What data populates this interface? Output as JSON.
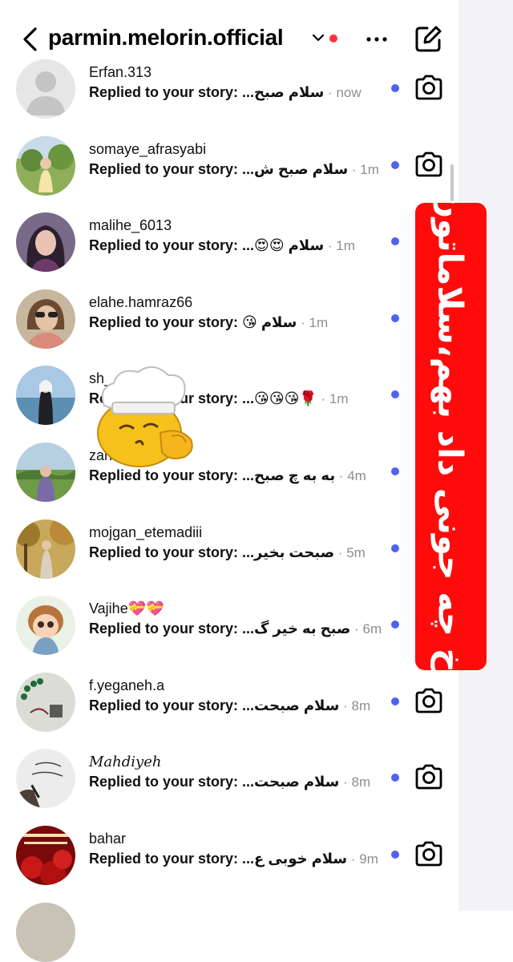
{
  "header": {
    "title": "parmin.melorin.official"
  },
  "threads": [
    {
      "username": "Erfan.313",
      "prefix": "Replied to your story:",
      "preview": "سلام صبح...",
      "time": "now",
      "avatar": "default",
      "camera": true
    },
    {
      "username": "somaye_afrasyabi",
      "prefix": "Replied to your story:",
      "preview": "سلام صبح ش...",
      "time": "1m",
      "avatar": "garden",
      "camera": true
    },
    {
      "username": "malihe_6013",
      "prefix": "Replied to your story:",
      "preview": "سلام 😍😍...",
      "time": "1m",
      "avatar": "portrait",
      "camera": false
    },
    {
      "username": "elahe.hamraz66",
      "prefix": "Replied to your story:",
      "preview": "سلام 😘",
      "time": "1m",
      "avatar": "sunglasses",
      "camera": false
    },
    {
      "username": "sh___ti",
      "prefix": "Replied to your story:",
      "preview": "🌹😘😘😘...",
      "time": "1m",
      "avatar": "beach",
      "camera": false
    },
    {
      "username": "zahra.r1998",
      "prefix": "Replied to your story:",
      "preview": "به به چ صبح...",
      "time": "4m",
      "avatar": "field",
      "camera": false
    },
    {
      "username": "mojgan_etemadiii",
      "prefix": "Replied to your story:",
      "preview": "صبحت بخیر...",
      "time": "5m",
      "avatar": "autumn",
      "camera": false
    },
    {
      "username": "Vajihe💝💝",
      "prefix": "Replied to your story:",
      "preview": "صبح به خیر گ...",
      "time": "6m",
      "avatar": "doll",
      "camera": false
    },
    {
      "username": "f.yeganeh.a",
      "prefix": "Replied to your story:",
      "preview": "سلام صبحت...",
      "time": "8m",
      "avatar": "beads",
      "camera": true
    },
    {
      "username": "Mahdiyeh",
      "prefix": "Replied to your story:",
      "preview": "سلام صبحت...",
      "time": "8m",
      "avatar": "writing",
      "camera": true
    },
    {
      "username": "bahar",
      "prefix": "Replied to your story:",
      "preview": "سلام خوبی ع...",
      "time": "9m",
      "avatar": "red",
      "camera": true
    }
  ],
  "overlay": {
    "banner_text": "اخ چه جونی داد بهم،سلاماتون",
    "banner_color": "#ff0b0b"
  },
  "colors": {
    "unread_dot": "#4f62f2",
    "notification_dot": "#ff3040",
    "timestamp": "#8e8e8e"
  },
  "icons": [
    "back-arrow-icon",
    "chevron-down-icon",
    "more-icon",
    "compose-icon",
    "camera-icon"
  ]
}
